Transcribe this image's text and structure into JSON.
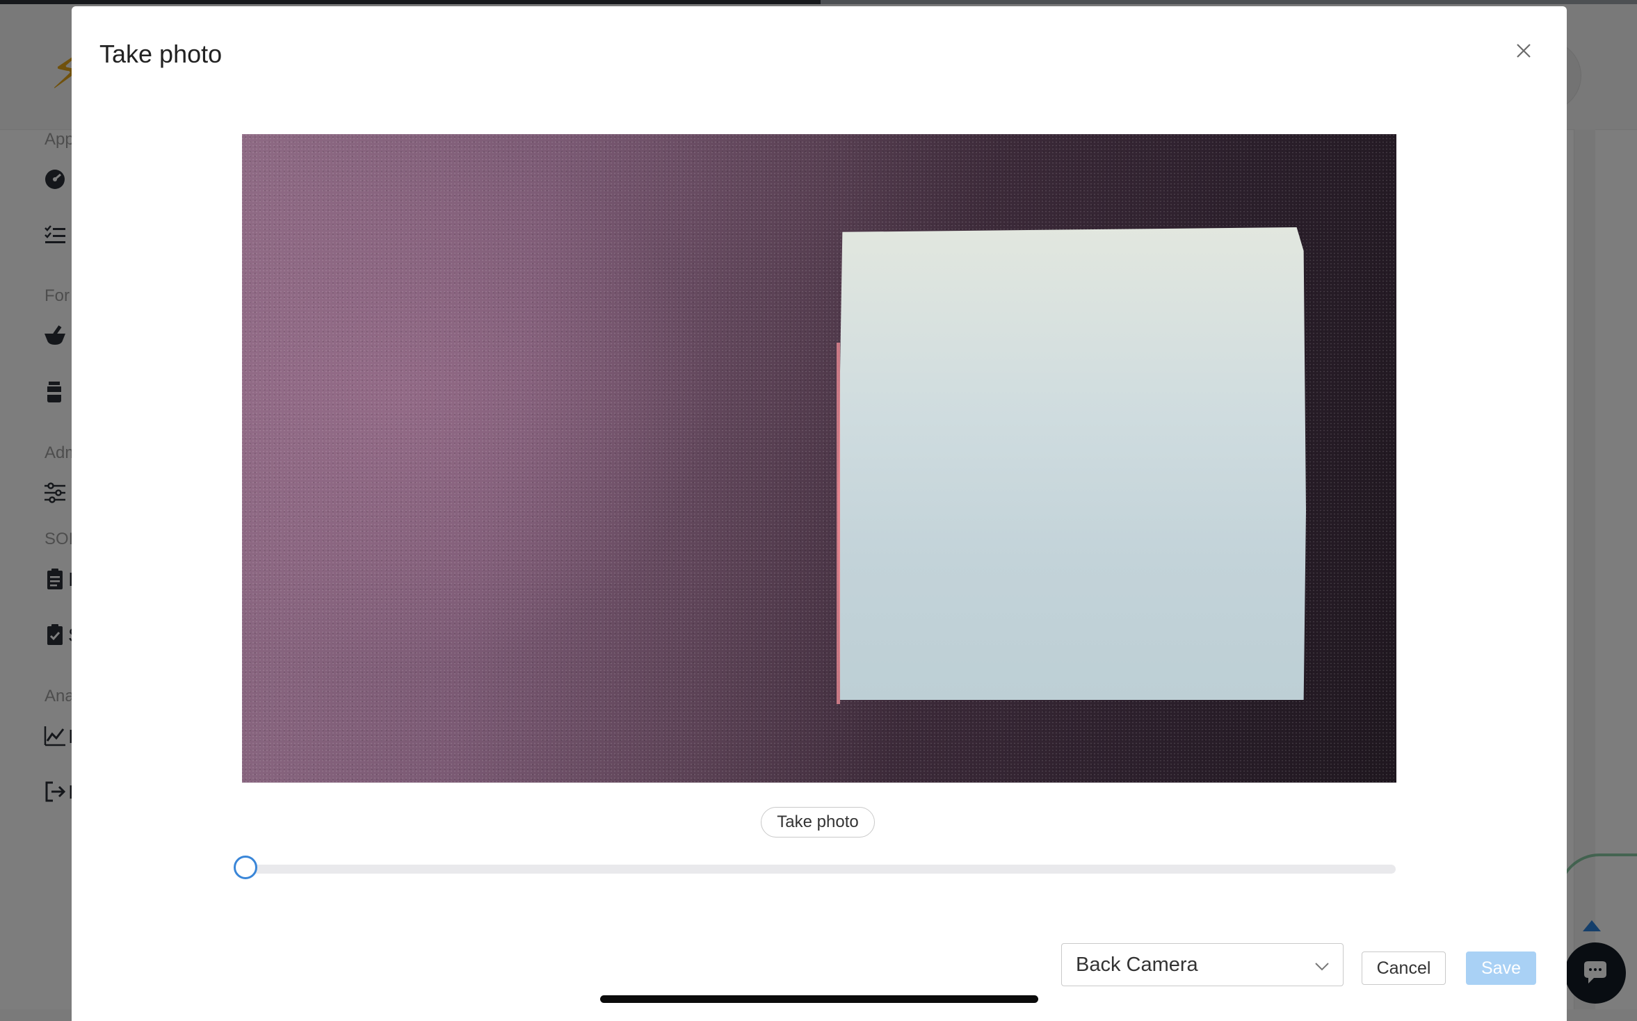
{
  "background_app": {
    "sidebar_headings": [
      "App",
      "For",
      "Adm",
      "SOI",
      "Ana"
    ],
    "sidebar_item_letters": [
      "I",
      "S",
      "I",
      "I"
    ],
    "chat_icon": "chat-bubble-icon",
    "scroll_top_icon": "caret-up-icon"
  },
  "dialog": {
    "title": "Take photo",
    "close_icon": "close-icon",
    "take_photo_label": "Take photo",
    "zoom_value": 0,
    "camera_select": {
      "selected": "Back Camera"
    },
    "cancel_label": "Cancel",
    "save_label": "Save"
  },
  "colors": {
    "accent": "#3a86d8",
    "save_disabled": "#a9d1f5",
    "overlay": "rgba(0,0,0,0.5)"
  }
}
